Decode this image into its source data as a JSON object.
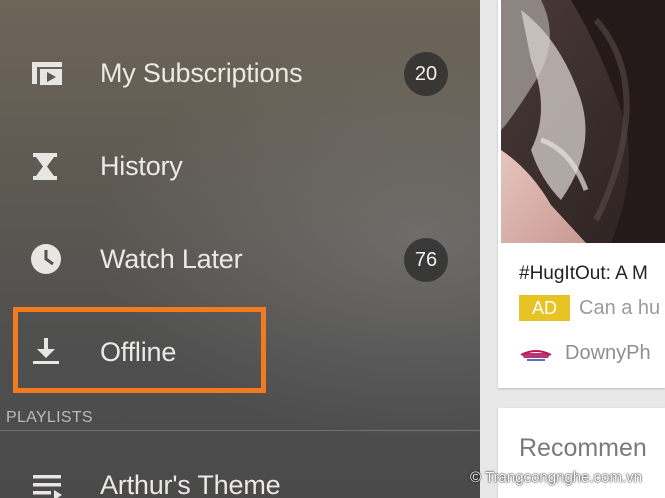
{
  "drawer": {
    "items": [
      {
        "label": "My Subscriptions",
        "icon": "subscriptions-icon",
        "count": "20"
      },
      {
        "label": "History",
        "icon": "hourglass-icon"
      },
      {
        "label": "Watch Later",
        "icon": "clock-icon",
        "count": "76"
      },
      {
        "label": "Offline",
        "icon": "download-icon"
      }
    ],
    "playlists_header": "PLAYLISTS",
    "playlists": [
      {
        "label": "Arthur's Theme",
        "icon": "playlist-icon"
      }
    ],
    "highlight_color": "#f47a1f"
  },
  "feed": {
    "video": {
      "title": "#HugItOut: A M",
      "ad_badge": "AD",
      "ad_text": "Can a hu",
      "channel": "DownyPh"
    },
    "recommended_title": "Recommen"
  },
  "watermark": "© Trangcongnghe.com.vn",
  "colors": {
    "ad_yellow": "#e7c325",
    "drawer_text": "#ece9e4"
  }
}
